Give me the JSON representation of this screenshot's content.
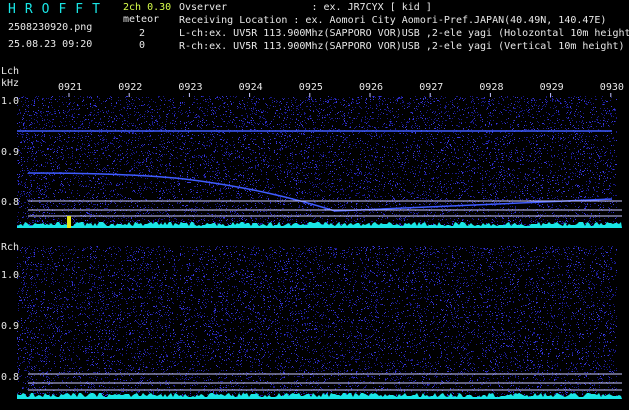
{
  "header": {
    "logo": "HROFFT",
    "filename": "2508230920.png",
    "datetime": "25.08.23 09:20",
    "channel": "2ch 0.30",
    "meteor_label": "meteor",
    "meteor_lch": "2",
    "meteor_rch": "0",
    "observer": "Ovserver              : ex. JR7CYX [ kid ]",
    "location": "Receiving Location : ex. Aomori City Aomori-Pref.JAPAN(40.49N, 140.47E)",
    "lch_info": "L-ch:ex. UV5R 113.900Mhz(SAPPORO VOR)USB ,2-ele yagi (Holozontal 10m height)",
    "rch_info": "R-ch:ex. UV5R 113.900Mhz(SAPPORO VOR)USB ,2-ele yagi (Vertical 10m height)"
  },
  "lch_panel": {
    "label": "Lch",
    "unit": "kHz",
    "yticks": [
      "1.0",
      "0.9",
      "0.8"
    ],
    "time_ticks": [
      "0921",
      "0922",
      "0923",
      "0924",
      "0925",
      "0926",
      "0927",
      "0928",
      "0929",
      "0930"
    ]
  },
  "rch_panel": {
    "label": "Rch",
    "yticks": [
      "1.0",
      "0.9",
      "0.8"
    ]
  },
  "colors": {
    "background": "#000000",
    "noise": "#1a1a8c",
    "noise_bright": "#3a3ae0",
    "trace": "#3f5cff",
    "refline": "#c8c8ff",
    "level": "#19e6e6",
    "meteor_peak": "#e6e619",
    "text": "#e8e8e8",
    "accent": "#19e6e6"
  }
}
